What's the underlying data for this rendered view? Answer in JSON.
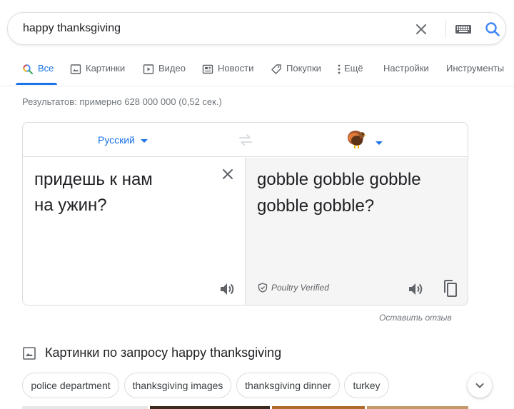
{
  "search": {
    "query": "happy thanksgiving"
  },
  "tabs": [
    {
      "label": "Все",
      "icon": "search-icon",
      "active": true
    },
    {
      "label": "Картинки",
      "icon": "image-icon"
    },
    {
      "label": "Видео",
      "icon": "video-icon"
    },
    {
      "label": "Новости",
      "icon": "news-icon"
    },
    {
      "label": "Покупки",
      "icon": "tag-icon"
    },
    {
      "label": "Ещё",
      "icon": "more-vert-icon"
    },
    {
      "label": "Настройки"
    },
    {
      "label": "Инструменты"
    }
  ],
  "result_stats": "Результатов: примерно 628 000 000 (0,52 сек.)",
  "translate": {
    "source_lang": "Русский",
    "target_lang_icon": "turkey-icon",
    "source_text": "придешь к нам\nна ужин?",
    "target_text": "gobble gobble gobble\ngobble gobble?",
    "verified_label": "Poultry Verified",
    "feedback": "Оставить отзыв"
  },
  "images_section": {
    "heading": "Картинки по запросу happy thanksgiving",
    "chips": [
      "police department",
      "thanksgiving images",
      "thanksgiving dinner",
      "turkey"
    ]
  },
  "colors": {
    "accent": "#1a73e8",
    "muted_text": "#70757a",
    "border": "#dadce0",
    "target_pane_bg": "#f5f5f5"
  }
}
